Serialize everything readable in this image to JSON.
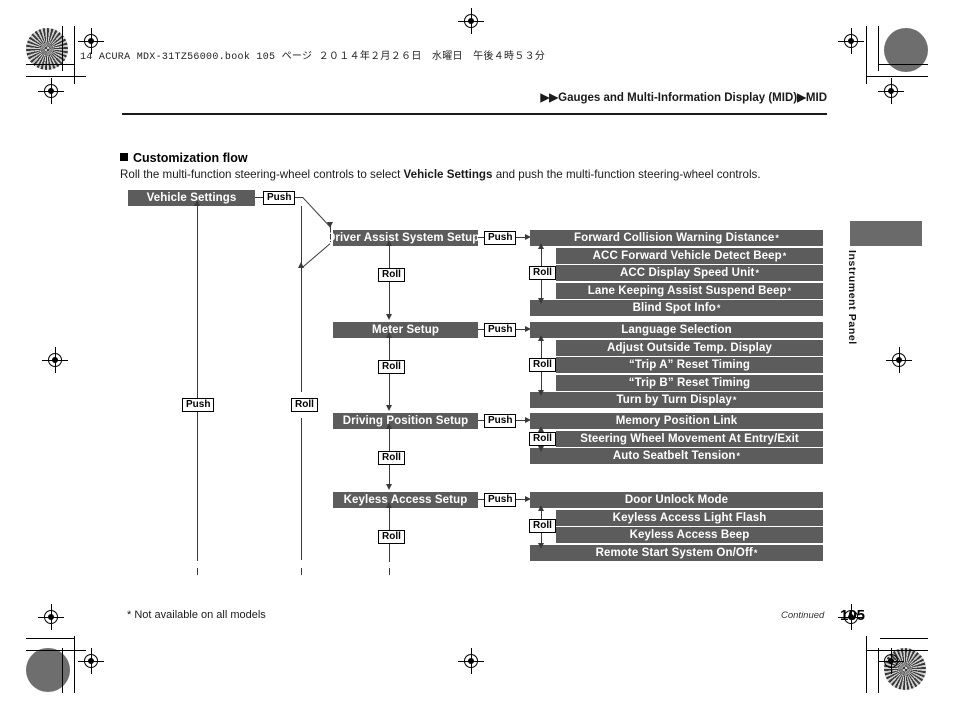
{
  "page": {
    "book_line": "14 ACURA MDX-31TZ56000.book  105 ページ   ２０１４年２月２６日　水曜日　午後４時５３分",
    "breadcrumb": "▶▶Gauges and Multi-Information Display (MID)▶MID",
    "section_title": "Customization flow",
    "intro_before": "Roll the multi-function steering-wheel controls to select ",
    "intro_bold": "Vehicle Settings",
    "intro_after": " and push the multi-function steering-wheel controls.",
    "footnote": "* Not available on all models",
    "continued": "Continued",
    "page_number": "105",
    "side_tab_label": "Instrument Panel"
  },
  "colors": {
    "bar": "#5c5c5c",
    "tab": "#6a6a6a",
    "line": "#3a3a3a",
    "text_on_bar": "#ffffff"
  },
  "labels": {
    "push": "Push",
    "roll": "Roll"
  },
  "flow": {
    "root": {
      "label": "Vehicle Settings",
      "asterisk": false
    },
    "menus": [
      {
        "label": "Driver Assist System Setup",
        "asterisk": true,
        "items": [
          {
            "label": "Forward Collision Warning Distance",
            "asterisk": true
          },
          {
            "label": "ACC Forward Vehicle Detect Beep",
            "asterisk": true
          },
          {
            "label": "ACC Display Speed Unit",
            "asterisk": true
          },
          {
            "label": "Lane Keeping Assist Suspend Beep",
            "asterisk": true
          },
          {
            "label": "Blind Spot Info",
            "asterisk": true
          }
        ]
      },
      {
        "label": "Meter Setup",
        "asterisk": false,
        "items": [
          {
            "label": "Language Selection",
            "asterisk": false
          },
          {
            "label": "Adjust Outside Temp. Display",
            "asterisk": false
          },
          {
            "label": "“Trip A” Reset Timing",
            "asterisk": false
          },
          {
            "label": "“Trip B” Reset Timing",
            "asterisk": false
          },
          {
            "label": "Turn by Turn Display",
            "asterisk": true
          }
        ]
      },
      {
        "label": "Driving Position Setup",
        "asterisk": false,
        "items": [
          {
            "label": "Memory Position Link",
            "asterisk": false
          },
          {
            "label": "Steering Wheel Movement At Entry/Exit",
            "asterisk": false
          },
          {
            "label": "Auto Seatbelt Tension",
            "asterisk": true
          }
        ]
      },
      {
        "label": "Keyless Access Setup",
        "asterisk": false,
        "items": [
          {
            "label": "Door Unlock Mode",
            "asterisk": false
          },
          {
            "label": "Keyless Access Light Flash",
            "asterisk": false
          },
          {
            "label": "Keyless Access Beep",
            "asterisk": false
          },
          {
            "label": "Remote Start System On/Off",
            "asterisk": true
          }
        ]
      }
    ]
  }
}
